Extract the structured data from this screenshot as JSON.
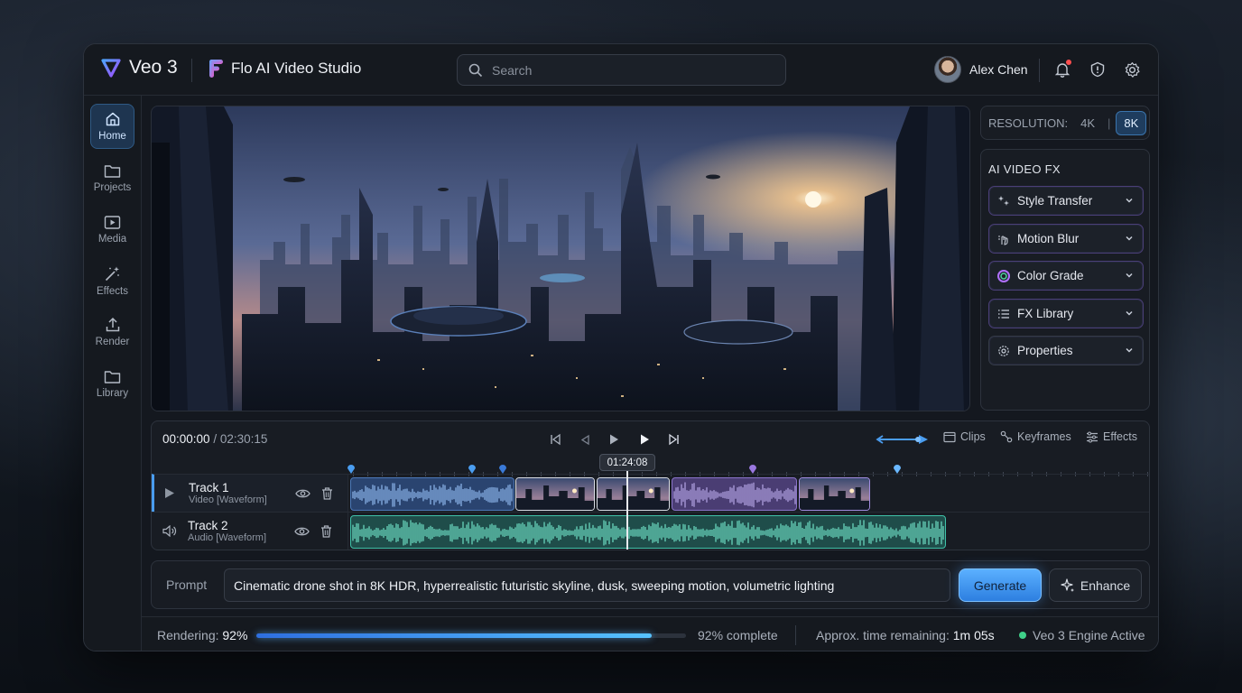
{
  "header": {
    "app_name": "Veo 3",
    "studio_name": "Flo AI Video Studio",
    "search_placeholder": "Search",
    "user_name": "Alex Chen"
  },
  "sidebar": {
    "items": [
      {
        "label": "Home",
        "icon": "home-icon",
        "active": true
      },
      {
        "label": "Projects",
        "icon": "folder-icon"
      },
      {
        "label": "Media",
        "icon": "media-play-icon"
      },
      {
        "label": "Effects",
        "icon": "magic-wand-icon"
      },
      {
        "label": "Render",
        "icon": "upload-icon"
      },
      {
        "label": "Library",
        "icon": "folder-icon"
      }
    ]
  },
  "resolution": {
    "label": "RESOLUTION:",
    "options": [
      "4K",
      "8K"
    ],
    "selected": "8K",
    "separator": "|"
  },
  "fx_panel": {
    "title": "AI VIDEO FX",
    "items": [
      {
        "label": "Style Transfer",
        "icon": "sparkles-icon"
      },
      {
        "label": "Motion Blur",
        "icon": "motion-hand-icon"
      },
      {
        "label": "Color Grade",
        "icon": "color-wheel-icon"
      },
      {
        "label": "FX Library",
        "icon": "list-icon"
      },
      {
        "label": "Properties",
        "icon": "settings-icon"
      }
    ]
  },
  "timeline": {
    "current_time": "00:00:00",
    "separator": "/",
    "total_time": "02:30:15",
    "playhead_time": "01:24:08",
    "tools": [
      "Clips",
      "Keyframes",
      "Effects"
    ],
    "tracks": [
      {
        "name": "Track 1",
        "type": "Video [Waveform]",
        "icon": "play-icon"
      },
      {
        "name": "Track 2",
        "type": "Audio [Waveform]",
        "icon": "speaker-icon"
      }
    ]
  },
  "prompt": {
    "label": "Prompt",
    "value": "Cinematic drone shot in 8K HDR, hyperrealistic futuristic skyline, dusk, sweeping motion, volumetric lighting",
    "generate_label": "Generate",
    "enhance_label": "Enhance"
  },
  "status": {
    "rendering_label": "Rendering:",
    "rendering_percent": "92%",
    "progress": 0.92,
    "complete_text": "92% complete",
    "remaining_label": "Approx. time remaining:",
    "remaining_value": "1m 05s",
    "engine_text": "Veo 3 Engine Active"
  },
  "colors": {
    "accent": "#4a9df0",
    "active_green": "#3fd089",
    "clip_purple": "#8a73c9",
    "audio_teal": "#3fc1a8"
  }
}
